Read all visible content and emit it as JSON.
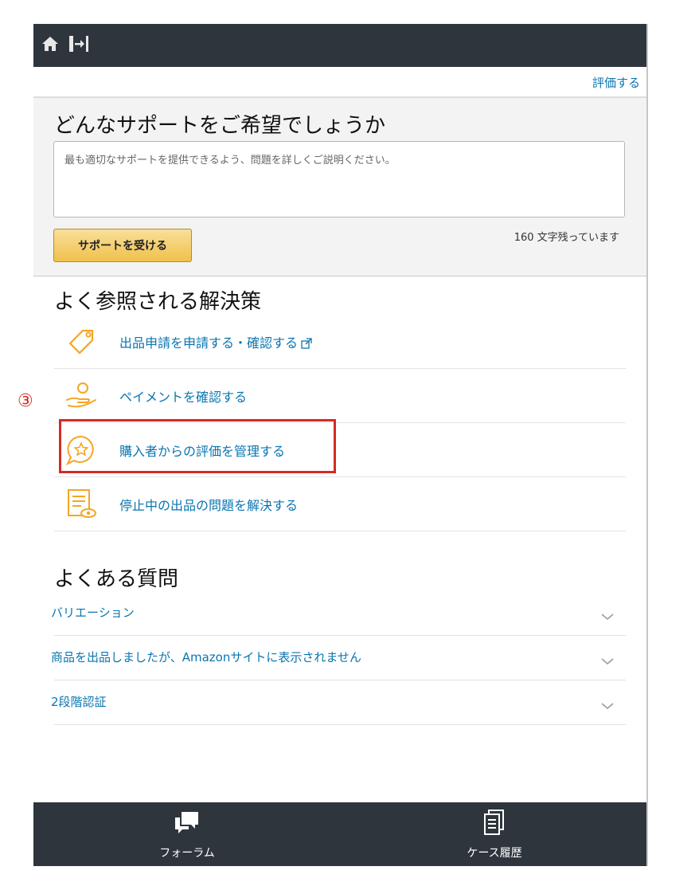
{
  "toolbar": {
    "rate_link": "評価する"
  },
  "support": {
    "title": "どんなサポートをご希望でしょうか",
    "placeholder": "最も適切なサポートを提供できるよう、問題を詳しくご説明ください。",
    "chars_left": "160 文字残っています",
    "button": "サポートを受ける"
  },
  "solutions": {
    "title": "よく参照される解決策",
    "items": [
      {
        "label": "出品申請を申請する・確認する",
        "icon": "tag-icon"
      },
      {
        "label": "ペイメントを確認する",
        "icon": "payment-hand-icon"
      },
      {
        "label": "購入者からの評価を管理する",
        "icon": "star-chat-icon"
      },
      {
        "label": "停止中の出品の問題を解決する",
        "icon": "listing-view-icon"
      }
    ]
  },
  "annotation": {
    "marker": "③"
  },
  "faq": {
    "title": "よくある質問",
    "items": [
      {
        "label": "バリエーション"
      },
      {
        "label": "商品を出品しましたが、Amazonサイトに表示されません"
      },
      {
        "label": "2段階認証"
      }
    ]
  },
  "tabs": [
    {
      "label": "フォーラム",
      "icon": "forum-icon"
    },
    {
      "label": "ケース履歴",
      "icon": "case-history-icon"
    }
  ],
  "colors": {
    "header": "#2e353d",
    "link": "#0a75b0",
    "accent": "#f0c14b",
    "icon_orange": "#f5a623",
    "highlight": "#d42a24"
  }
}
